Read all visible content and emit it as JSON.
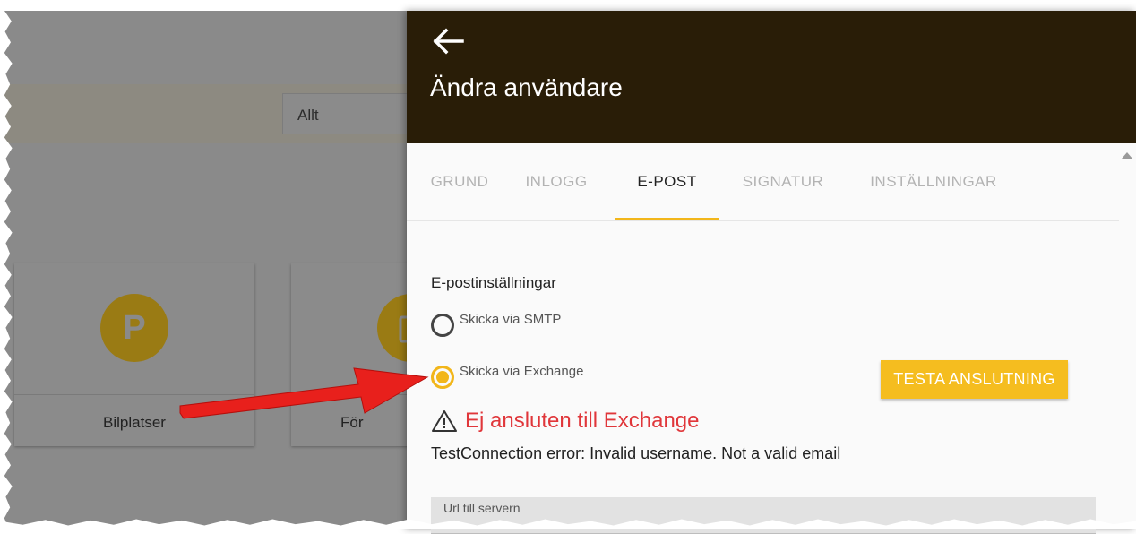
{
  "background": {
    "filter_value": "Allt",
    "cards": [
      {
        "label": "Bilplatser",
        "icon": "parking-icon",
        "icon_text": "P"
      },
      {
        "label": "För",
        "icon": "clipboard-icon"
      }
    ]
  },
  "panel": {
    "back_icon": "arrow-back-icon",
    "title": "Ändra användare",
    "tabs": [
      {
        "label": "GRUND",
        "active": false
      },
      {
        "label": "INLOGG",
        "active": false
      },
      {
        "label": "E-POST",
        "active": true
      },
      {
        "label": "SIGNATUR",
        "active": false
      },
      {
        "label": "INSTÄLLNINGAR",
        "active": false
      }
    ],
    "email_settings": {
      "title": "E-postinställningar",
      "options": [
        {
          "label": "Skicka via SMTP",
          "checked": false
        },
        {
          "label": "Skicka via Exchange",
          "checked": true
        }
      ],
      "test_button": "TESTA ANSLUTNING",
      "error_title": "Ej ansluten till Exchange",
      "error_detail": "TestConnection error: Invalid username. Not a valid email",
      "url_field_label": "Url till servern"
    }
  },
  "colors": {
    "header_bg": "#291d07",
    "accent": "#f2b61a",
    "error": "#e0363a",
    "annotation_arrow": "#e8201c"
  }
}
